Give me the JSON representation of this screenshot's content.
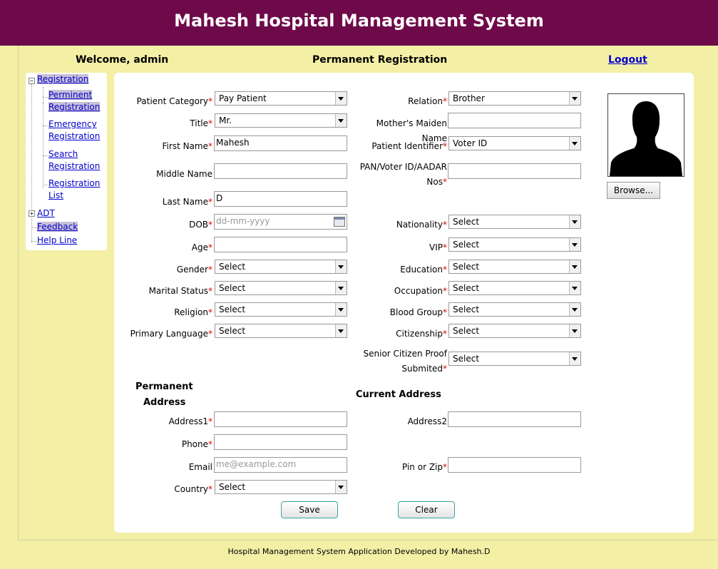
{
  "header": {
    "title": "Mahesh Hospital Management System"
  },
  "topbar": {
    "welcome": "Welcome, admin",
    "page_title": "Permanent Registration",
    "logout": "Logout"
  },
  "sidebar": {
    "registration": "Registration",
    "reg_items": [
      [
        "Perminent",
        "Registration"
      ],
      [
        "Emergency",
        "Registration"
      ],
      [
        "Search",
        "Registration"
      ],
      [
        "Registration",
        "List"
      ]
    ],
    "adt": "ADT",
    "feedback": "Feedback",
    "helpline": "Help Line"
  },
  "left_fields": {
    "patient_category": {
      "label": "Patient Category",
      "value": "Pay Patient"
    },
    "title": {
      "label": "Title",
      "value": "Mr."
    },
    "first_name": {
      "label": "First Name",
      "value": "Mahesh"
    },
    "middle_name": {
      "label": "Middle Name",
      "value": ""
    },
    "last_name": {
      "label": "Last Name",
      "value": "D"
    },
    "dob": {
      "label": "DOB",
      "placeholder": "dd-mm-yyyy"
    },
    "age": {
      "label": "Age",
      "value": ""
    },
    "gender": {
      "label": "Gender",
      "value": "Select"
    },
    "marital_status": {
      "label": "Marital Status",
      "value": "Select"
    },
    "religion": {
      "label": "Religion",
      "value": "Select"
    },
    "primary_language": {
      "label": "Primary Language",
      "value": "Select"
    }
  },
  "right_fields": {
    "relation": {
      "label": "Relation",
      "value": "Brother"
    },
    "mothers_maiden_name": {
      "label": "Mother's Maiden Name",
      "value": ""
    },
    "patient_identifier": {
      "label": "Patient Identifier",
      "value": "Voter ID"
    },
    "pan_voter_id": {
      "label_line1": "PAN/Voter ID/AADAR",
      "label_line2": "Nos",
      "value": ""
    },
    "nationality": {
      "label": "Nationality",
      "value": "Select"
    },
    "vip": {
      "label": "VIP",
      "value": "Select"
    },
    "education": {
      "label": "Education",
      "value": "Select"
    },
    "occupation": {
      "label": "Occupation",
      "value": "Select"
    },
    "blood_group": {
      "label": "Blood Group",
      "value": "Select"
    },
    "citizenship": {
      "label": "Citizenship",
      "value": "Select"
    },
    "senior_citizen": {
      "label_line1": "Senior Citizen Proof",
      "label_line2": "Submited",
      "value": "Select"
    }
  },
  "permanent_address": {
    "heading_line1": "Permanent",
    "heading_line2": "Address",
    "address1": {
      "label": "Address1",
      "value": ""
    },
    "phone": {
      "label": "Phone",
      "value": ""
    },
    "email": {
      "label": "Email",
      "placeholder": "me@example.com"
    },
    "country": {
      "label": "Country",
      "value": "Select"
    }
  },
  "current_address": {
    "heading": "Current Address",
    "address2": {
      "label": "Address2",
      "value": ""
    },
    "pin": {
      "label": "Pin or Zip",
      "value": ""
    }
  },
  "photo": {
    "browse_label": "Browse..."
  },
  "buttons": {
    "save": "Save",
    "clear": "Clear"
  },
  "footer": {
    "text": "Hospital Management System Application Developed by Mahesh.D"
  },
  "colors": {
    "header_bg": "#6e0a4a",
    "page_bg": "#f3efa5",
    "required": "#e00000",
    "link": "#0000cc"
  }
}
